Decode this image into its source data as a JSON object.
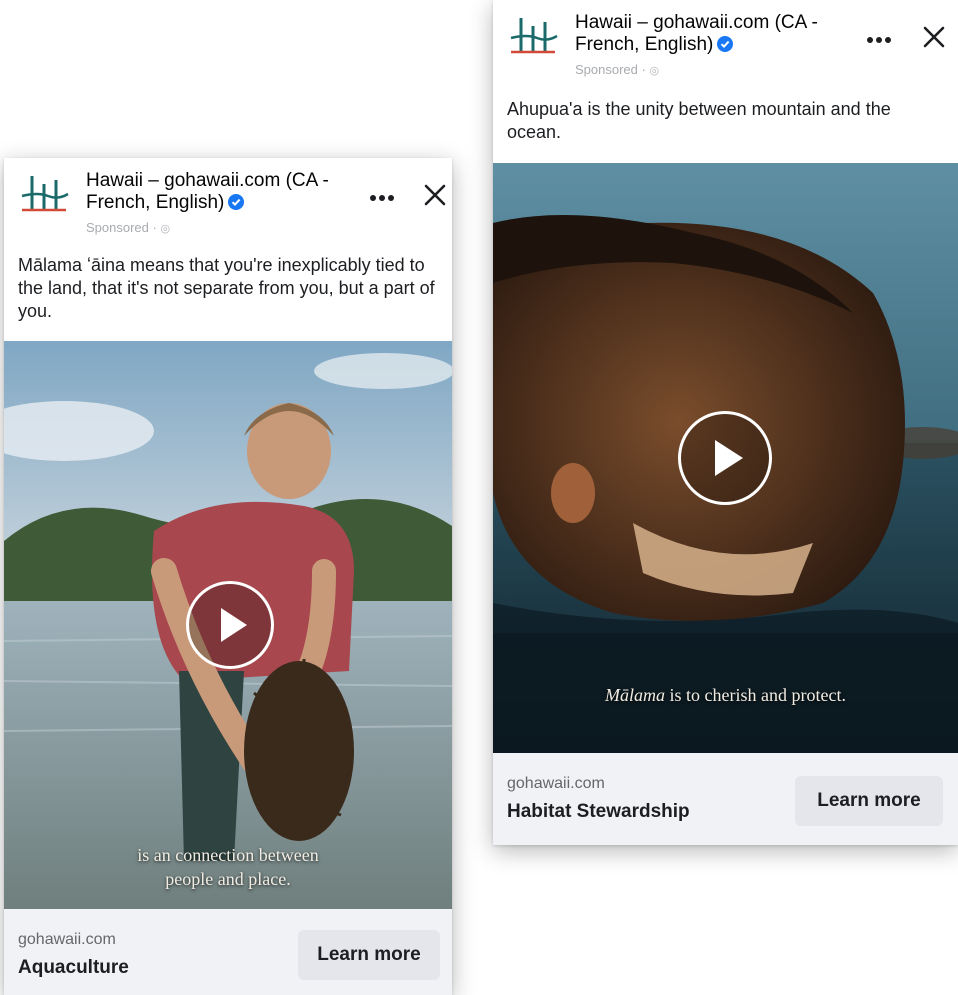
{
  "ads": [
    {
      "page_name": "Hawaii – gohawaii.com (CA - French, English)",
      "sponsored_label": "Sponsored · ",
      "primary_text": "Mālama ʻāina means that you're inexplicably tied to the land, that it's not separate from you, but a part of you.",
      "caption_line1": "is an connection between",
      "caption_line2": "people and place.",
      "domain": "gohawaii.com",
      "headline": "Aquaculture",
      "cta_label": "Learn more"
    },
    {
      "page_name": "Hawaii – gohawaii.com (CA - French, English)",
      "sponsored_label": "Sponsored · ",
      "primary_text": "Ahupua'a is the unity between mountain and the ocean.",
      "caption_word": "Mālama",
      "caption_rest": " is to cherish and protect.",
      "domain": "gohawaii.com",
      "headline": "Habitat Stewardship",
      "cta_label": "Learn more"
    }
  ],
  "icons": {
    "logo": "hawaii-tourism-logo",
    "verified": "verified-badge-icon",
    "more": "more-options-icon",
    "close": "close-icon",
    "play": "play-icon",
    "audience": "globe-icon"
  },
  "colors": {
    "verified_blue": "#1877f2",
    "footer_bg": "#f0f2f5",
    "cta_bg": "#e4e6eb",
    "logo_teal": "#1b6a6a",
    "logo_red": "#d24b3a"
  }
}
